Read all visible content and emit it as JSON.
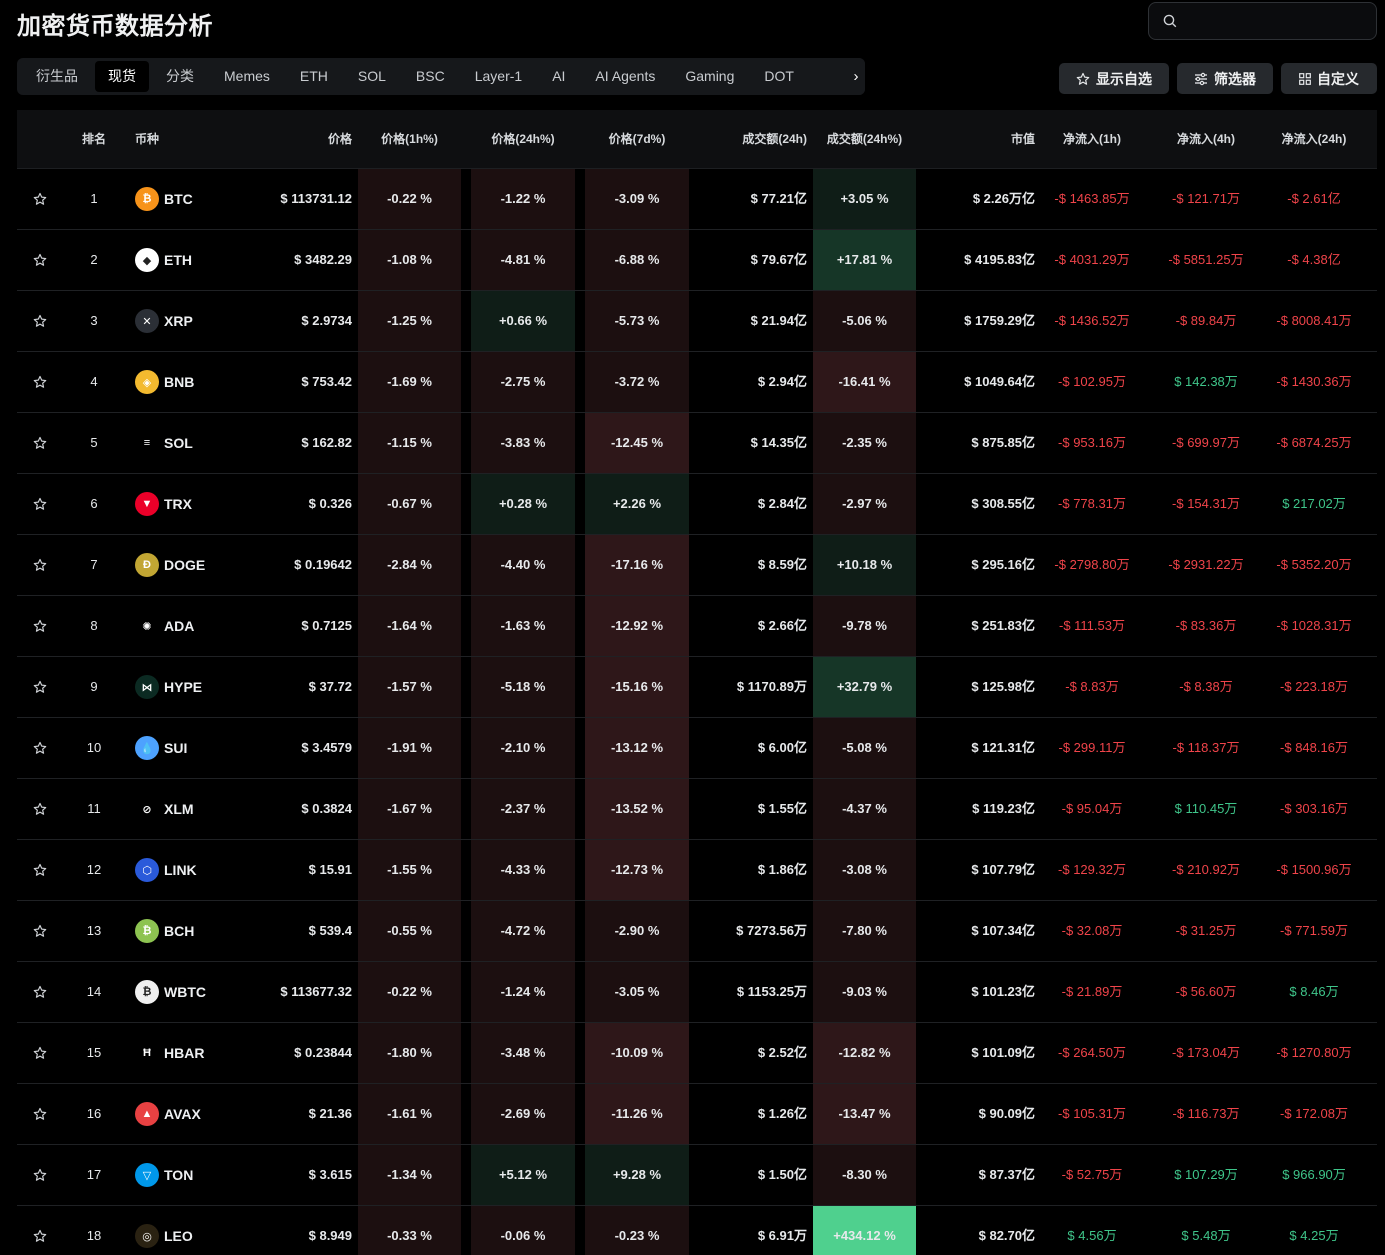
{
  "title": "加密货币数据分析",
  "search": {
    "placeholder": ""
  },
  "tabs": [
    "衍生品",
    "现货",
    "分类",
    "Memes",
    "ETH",
    "SOL",
    "BSC",
    "Layer-1",
    "AI",
    "AI Agents",
    "Gaming",
    "DOT"
  ],
  "active_tab": 1,
  "buttons": {
    "watchlist": "显示自选",
    "filter": "筛选器",
    "customize": "自定义"
  },
  "headers": {
    "rank": "排名",
    "coin": "币种",
    "price": "价格",
    "chg1h": "价格(1h%)",
    "chg24h": "价格(24h%)",
    "chg7d": "价格(7d%)",
    "vol": "成交额(24h)",
    "volchg": "成交额(24h%)",
    "mcap": "市值",
    "flow1h": "净流入(1h)",
    "flow4h": "净流入(4h)",
    "flow24h": "净流入(24h)"
  },
  "colors": {
    "neg_bg_light": "#1c0f10",
    "neg_bg_mid": "#2e1719",
    "pos_bg_light": "#0f1d17",
    "pos_bg_mid": "#163627",
    "pos_bg_strong": "#4fd08e",
    "neg_text": "#f0444a",
    "pos_text": "#3fc58a"
  },
  "rows": [
    {
      "rank": "1",
      "sym": "BTC",
      "icon": "bitcoin-icon",
      "color": "#f7931a",
      "glyph": "₿",
      "price": "$ 113731.12",
      "c1h": "-0.22 %",
      "c24h": "-1.22 %",
      "c7d": "-3.09 %",
      "vol": "$ 77.21亿",
      "volchg": "+3.05 %",
      "mcap": "$ 2.26万亿",
      "f1": "-$ 1463.85万",
      "f4": "-$ 121.71万",
      "f24": "-$ 2.61亿"
    },
    {
      "rank": "2",
      "sym": "ETH",
      "icon": "ethereum-icon",
      "color": "#ffffff",
      "glyph": "◆",
      "price": "$ 3482.29",
      "c1h": "-1.08 %",
      "c24h": "-4.81 %",
      "c7d": "-6.88 %",
      "vol": "$ 79.67亿",
      "volchg": "+17.81 %",
      "mcap": "$ 4195.83亿",
      "f1": "-$ 4031.29万",
      "f4": "-$ 5851.25万",
      "f24": "-$ 4.38亿"
    },
    {
      "rank": "3",
      "sym": "XRP",
      "icon": "xrp-icon",
      "color": "#2b2f36",
      "glyph": "✕",
      "price": "$ 2.9734",
      "c1h": "-1.25 %",
      "c24h": "+0.66 %",
      "c7d": "-5.73 %",
      "vol": "$ 21.94亿",
      "volchg": "-5.06 %",
      "mcap": "$ 1759.29亿",
      "f1": "-$ 1436.52万",
      "f4": "-$ 89.84万",
      "f24": "-$ 8008.41万"
    },
    {
      "rank": "4",
      "sym": "BNB",
      "icon": "bnb-icon",
      "color": "#f3ba2f",
      "glyph": "◈",
      "price": "$ 753.42",
      "c1h": "-1.69 %",
      "c24h": "-2.75 %",
      "c7d": "-3.72 %",
      "vol": "$ 2.94亿",
      "volchg": "-16.41 %",
      "mcap": "$ 1049.64亿",
      "f1": "-$ 102.95万",
      "f4": "$ 142.38万",
      "f24": "-$ 1430.36万"
    },
    {
      "rank": "5",
      "sym": "SOL",
      "icon": "solana-icon",
      "color": "#000000",
      "glyph": "≡",
      "price": "$ 162.82",
      "c1h": "-1.15 %",
      "c24h": "-3.83 %",
      "c7d": "-12.45 %",
      "vol": "$ 14.35亿",
      "volchg": "-2.35 %",
      "mcap": "$ 875.85亿",
      "f1": "-$ 953.16万",
      "f4": "-$ 699.97万",
      "f24": "-$ 6874.25万"
    },
    {
      "rank": "6",
      "sym": "TRX",
      "icon": "tron-icon",
      "color": "#eb0029",
      "glyph": "▼",
      "price": "$ 0.326",
      "c1h": "-0.67 %",
      "c24h": "+0.28 %",
      "c7d": "+2.26 %",
      "vol": "$ 2.84亿",
      "volchg": "-2.97 %",
      "mcap": "$ 308.55亿",
      "f1": "-$ 778.31万",
      "f4": "-$ 154.31万",
      "f24": "$ 217.02万"
    },
    {
      "rank": "7",
      "sym": "DOGE",
      "icon": "dogecoin-icon",
      "color": "#c2a633",
      "glyph": "Ð",
      "price": "$ 0.19642",
      "c1h": "-2.84 %",
      "c24h": "-4.40 %",
      "c7d": "-17.16 %",
      "vol": "$ 8.59亿",
      "volchg": "+10.18 %",
      "mcap": "$ 295.16亿",
      "f1": "-$ 2798.80万",
      "f4": "-$ 2931.22万",
      "f24": "-$ 5352.20万"
    },
    {
      "rank": "8",
      "sym": "ADA",
      "icon": "cardano-icon",
      "color": "#000000",
      "glyph": "✺",
      "price": "$ 0.7125",
      "c1h": "-1.64 %",
      "c24h": "-1.63 %",
      "c7d": "-12.92 %",
      "vol": "$ 2.66亿",
      "volchg": "-9.78 %",
      "mcap": "$ 251.83亿",
      "f1": "-$ 111.53万",
      "f4": "-$ 83.36万",
      "f24": "-$ 1028.31万"
    },
    {
      "rank": "9",
      "sym": "HYPE",
      "icon": "hyperliquid-icon",
      "color": "#0b2a22",
      "glyph": "⋈",
      "price": "$ 37.72",
      "c1h": "-1.57 %",
      "c24h": "-5.18 %",
      "c7d": "-15.16 %",
      "vol": "$ 1170.89万",
      "volchg": "+32.79 %",
      "mcap": "$ 125.98亿",
      "f1": "-$ 8.83万",
      "f4": "-$ 8.38万",
      "f24": "-$ 223.18万"
    },
    {
      "rank": "10",
      "sym": "SUI",
      "icon": "sui-icon",
      "color": "#4da2ff",
      "glyph": "💧",
      "price": "$ 3.4579",
      "c1h": "-1.91 %",
      "c24h": "-2.10 %",
      "c7d": "-13.12 %",
      "vol": "$ 6.00亿",
      "volchg": "-5.08 %",
      "mcap": "$ 121.31亿",
      "f1": "-$ 299.11万",
      "f4": "-$ 118.37万",
      "f24": "-$ 848.16万"
    },
    {
      "rank": "11",
      "sym": "XLM",
      "icon": "stellar-icon",
      "color": "#000000",
      "glyph": "⊘",
      "price": "$ 0.3824",
      "c1h": "-1.67 %",
      "c24h": "-2.37 %",
      "c7d": "-13.52 %",
      "vol": "$ 1.55亿",
      "volchg": "-4.37 %",
      "mcap": "$ 119.23亿",
      "f1": "-$ 95.04万",
      "f4": "$ 110.45万",
      "f24": "-$ 303.16万"
    },
    {
      "rank": "12",
      "sym": "LINK",
      "icon": "chainlink-icon",
      "color": "#2a5ada",
      "glyph": "⬡",
      "price": "$ 15.91",
      "c1h": "-1.55 %",
      "c24h": "-4.33 %",
      "c7d": "-12.73 %",
      "vol": "$ 1.86亿",
      "volchg": "-3.08 %",
      "mcap": "$ 107.79亿",
      "f1": "-$ 129.32万",
      "f4": "-$ 210.92万",
      "f24": "-$ 1500.96万"
    },
    {
      "rank": "13",
      "sym": "BCH",
      "icon": "bitcoin-cash-icon",
      "color": "#8dc351",
      "glyph": "₿",
      "price": "$ 539.4",
      "c1h": "-0.55 %",
      "c24h": "-4.72 %",
      "c7d": "-2.90 %",
      "vol": "$ 7273.56万",
      "volchg": "-7.80 %",
      "mcap": "$ 107.34亿",
      "f1": "-$ 32.08万",
      "f4": "-$ 31.25万",
      "f24": "-$ 771.59万"
    },
    {
      "rank": "14",
      "sym": "WBTC",
      "icon": "wrapped-bitcoin-icon",
      "color": "#f0f0f0",
      "glyph": "₿",
      "price": "$ 113677.32",
      "c1h": "-0.22 %",
      "c24h": "-1.24 %",
      "c7d": "-3.05 %",
      "vol": "$ 1153.25万",
      "volchg": "-9.03 %",
      "mcap": "$ 101.23亿",
      "f1": "-$ 21.89万",
      "f4": "-$ 56.60万",
      "f24": "$ 8.46万"
    },
    {
      "rank": "15",
      "sym": "HBAR",
      "icon": "hedera-icon",
      "color": "#000000",
      "glyph": "Ħ",
      "price": "$ 0.23844",
      "c1h": "-1.80 %",
      "c24h": "-3.48 %",
      "c7d": "-10.09 %",
      "vol": "$ 2.52亿",
      "volchg": "-12.82 %",
      "mcap": "$ 101.09亿",
      "f1": "-$ 264.50万",
      "f4": "-$ 173.04万",
      "f24": "-$ 1270.80万"
    },
    {
      "rank": "16",
      "sym": "AVAX",
      "icon": "avalanche-icon",
      "color": "#e84142",
      "glyph": "▲",
      "price": "$ 21.36",
      "c1h": "-1.61 %",
      "c24h": "-2.69 %",
      "c7d": "-11.26 %",
      "vol": "$ 1.26亿",
      "volchg": "-13.47 %",
      "mcap": "$ 90.09亿",
      "f1": "-$ 105.31万",
      "f4": "-$ 116.73万",
      "f24": "-$ 172.08万"
    },
    {
      "rank": "17",
      "sym": "TON",
      "icon": "toncoin-icon",
      "color": "#0098ea",
      "glyph": "▽",
      "price": "$ 3.615",
      "c1h": "-1.34 %",
      "c24h": "+5.12 %",
      "c7d": "+9.28 %",
      "vol": "$ 1.50亿",
      "volchg": "-8.30 %",
      "mcap": "$ 87.37亿",
      "f1": "-$ 52.75万",
      "f4": "$ 107.29万",
      "f24": "$ 966.90万"
    },
    {
      "rank": "18",
      "sym": "LEO",
      "icon": "unus-sed-leo-icon",
      "color": "#2a2212",
      "glyph": "◎",
      "price": "$ 8.949",
      "c1h": "-0.33 %",
      "c24h": "-0.06 %",
      "c7d": "-0.23 %",
      "vol": "$ 6.91万",
      "volchg": "+434.12 %",
      "mcap": "$ 82.70亿",
      "f1": "$ 4.56万",
      "f4": "$ 5.48万",
      "f24": "$ 4.25万"
    }
  ]
}
